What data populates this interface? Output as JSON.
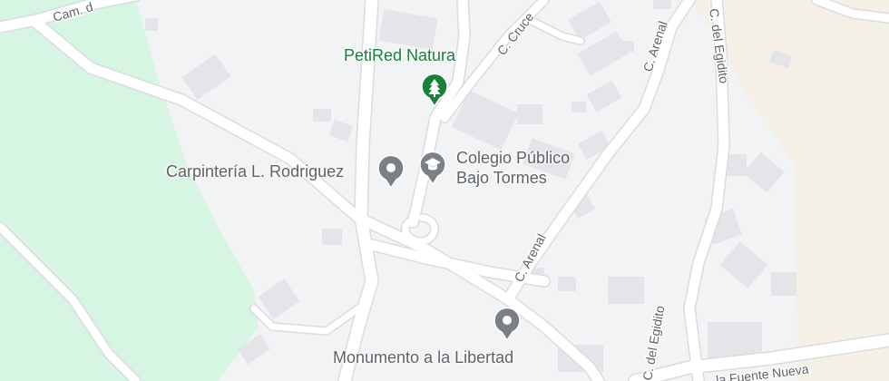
{
  "map": {
    "colors": {
      "background": "#f1f3f4",
      "park": "#d6f5e3",
      "sand": "#f5f0e6",
      "road": "#ffffff",
      "road_outline": "#dadce0",
      "building": "#e3e5e8",
      "park_poi": "#188038",
      "poi_gray": "#70757a",
      "label": "#5f6368"
    },
    "pois": [
      {
        "id": "petired",
        "name": "PetiRed Natura",
        "icon": "tree-icon",
        "category": "park"
      },
      {
        "id": "carpinteria",
        "name": "Carpintería L. Rodriguez",
        "icon": "dot-icon",
        "category": "shop"
      },
      {
        "id": "colegio",
        "name_line1": "Colegio Público",
        "name_line2": "Bajo Tormes",
        "icon": "school-icon",
        "category": "school"
      },
      {
        "id": "monumento",
        "name": "Monumento a la Libertad",
        "icon": "dot-icon",
        "category": "landmark"
      }
    ],
    "streets": {
      "cam": "Cam. d",
      "cruce": "C. Cruce",
      "arenal_upper": "C. Arenal",
      "arenal_lower": "C. Arenal",
      "egidito_upper": "C. del Egidito",
      "egidito_lower": "C. del Egidito",
      "fuente": "la Fuente Nueva"
    }
  }
}
